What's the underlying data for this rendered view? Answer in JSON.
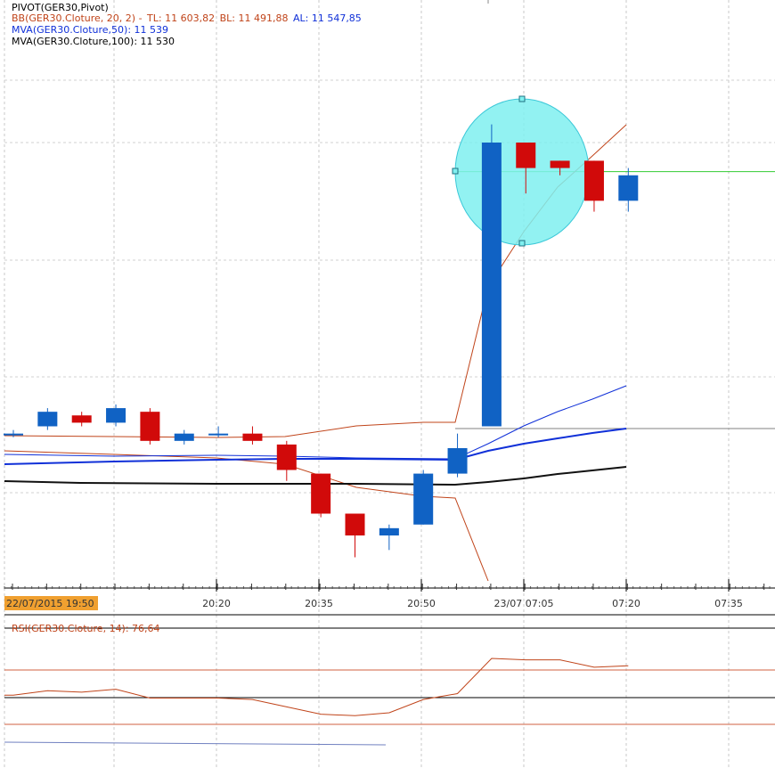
{
  "legend": {
    "pivot": "PIVOT(GER30,Pivot)",
    "bb_name": "BB(GER30.Cloture, 20, 2) -",
    "bb_tl": "TL: 11 603,82",
    "bb_bl": "BL: 11 491,88",
    "bb_al": "AL: 11 547,85",
    "mva50": "MVA(GER30.Cloture,50): 11 539",
    "mva100": "MVA(GER30.Cloture,100): 11 530",
    "rsi": "RSI(GER30.Cloture, 14): 76,64"
  },
  "colors": {
    "up": "#1062c4",
    "down": "#d10a0a",
    "bb": "#c0441a",
    "mva50": "#1030d8",
    "mva100": "#111111",
    "pivot": "#33cc33",
    "highlight": "#7ff0f0",
    "start_tag": "#f0a030"
  },
  "chart_data": [
    {
      "type": "candlestick",
      "title": "",
      "x_tick_labels": [
        "22/07/2015 19:50",
        "20:20",
        "20:35",
        "20:50",
        "23/07 07:05",
        "07:20",
        "07:35"
      ],
      "ylim": [
        11490,
        11620
      ],
      "candles": [
        {
          "open": 11530,
          "high": 11531,
          "low": 11529,
          "close": 11530
        },
        {
          "open": 11532,
          "high": 11537,
          "low": 11531,
          "close": 11536
        },
        {
          "open": 11535,
          "high": 11536,
          "low": 11532,
          "close": 11533
        },
        {
          "open": 11533,
          "high": 11538,
          "low": 11532,
          "close": 11537
        },
        {
          "open": 11536,
          "high": 11537,
          "low": 11527,
          "close": 11528
        },
        {
          "open": 11528,
          "high": 11531,
          "low": 11527,
          "close": 11530
        },
        {
          "open": 11530,
          "high": 11532,
          "low": 11529,
          "close": 11530
        },
        {
          "open": 11530,
          "high": 11532,
          "low": 11527,
          "close": 11528
        },
        {
          "open": 11527,
          "high": 11528,
          "low": 11517,
          "close": 11520
        },
        {
          "open": 11519,
          "high": 11519,
          "low": 11507,
          "close": 11508
        },
        {
          "open": 11508,
          "high": 11508,
          "low": 11496,
          "close": 11502
        },
        {
          "open": 11502,
          "high": 11505,
          "low": 11498,
          "close": 11504
        },
        {
          "open": 11505,
          "high": 11520,
          "low": 11505,
          "close": 11519
        },
        {
          "open": 11519,
          "high": 11530,
          "low": 11518,
          "close": 11526
        },
        {
          "open": 11532,
          "high": 11615,
          "low": 11532,
          "close": 11610
        },
        {
          "open": 11610,
          "high": 11610,
          "low": 11596,
          "close": 11603
        },
        {
          "open": 11605,
          "high": 11605,
          "low": 11601,
          "close": 11603
        },
        {
          "open": 11605,
          "high": 11605,
          "low": 11591,
          "close": 11594
        },
        {
          "open": 11594,
          "high": 11603,
          "low": 11591,
          "close": 11601
        }
      ],
      "bollinger_upper": [
        11536,
        11536,
        11536,
        11536,
        11536,
        11536,
        11536,
        11536,
        11536,
        11538,
        11539,
        11540,
        11540,
        11540,
        11580,
        11600,
        11610,
        11617,
        11625
      ],
      "bollinger_lower": [
        11536,
        11534,
        11534,
        11534,
        11534,
        11534,
        11534,
        11534,
        11525,
        11515,
        11510,
        11508,
        11506,
        11505,
        11475,
        null,
        null,
        null,
        null
      ],
      "mva50": [
        11527,
        11528,
        11528,
        11528,
        11527,
        11527,
        11527,
        11527,
        11527,
        11527,
        11527,
        11527,
        11527,
        11527,
        11532,
        11537,
        11543,
        11548,
        11553
      ],
      "mva100": [
        11518,
        11517,
        11517,
        11517,
        11516,
        11516,
        11516,
        11516,
        11516,
        11516,
        11516,
        11516,
        11516,
        11516,
        11518,
        11519,
        11520,
        11521,
        11522
      ],
      "mva50_line": [
        11529,
        11529,
        11529,
        11529,
        11529,
        11529,
        11529,
        11529,
        11528,
        11527,
        11527,
        11527,
        11527,
        11527,
        11533,
        11537,
        11540,
        11543,
        11546
      ],
      "pivot_level": 11602,
      "reference_level": 11546
    },
    {
      "type": "line",
      "title": "",
      "ylim": [
        0,
        100
      ],
      "levels": [
        70,
        50,
        30
      ],
      "series": [
        {
          "name": "RSI(GER30.Cloture, 14)",
          "values": [
            52,
            55,
            54,
            56,
            50,
            50,
            50,
            49,
            44,
            39,
            38,
            40,
            49,
            53,
            77,
            76,
            76,
            71,
            72
          ]
        }
      ]
    }
  ]
}
